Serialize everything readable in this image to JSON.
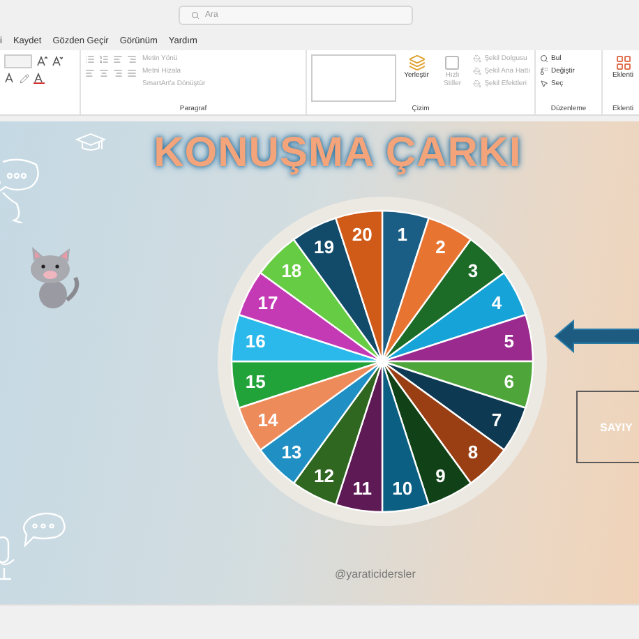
{
  "search": {
    "placeholder": "Ara"
  },
  "menu": [
    {
      "label": "i"
    },
    {
      "label": "Kaydet"
    },
    {
      "label": "Gözden Geçir"
    },
    {
      "label": "Görünüm"
    },
    {
      "label": "Yardım"
    }
  ],
  "ribbon": {
    "paragraph": {
      "label": "Paragraf",
      "commands": [
        {
          "label": "Metin Yönü",
          "disabled": true
        },
        {
          "label": "Metni Hizala",
          "disabled": true
        },
        {
          "label": "SmartArt'a Dönüştür",
          "disabled": true
        }
      ]
    },
    "drawing": {
      "label": "Çizim",
      "arrange": {
        "label": "Yerleştir",
        "disabled": false
      },
      "quick_styles": {
        "label": "Hızlı Stiller",
        "disabled": true
      },
      "commands": [
        {
          "label": "Şekil Dolgusu",
          "disabled": true
        },
        {
          "label": "Şekil Ana Hattı",
          "disabled": true
        },
        {
          "label": "Şekil Efektleri",
          "disabled": true
        }
      ]
    },
    "editing": {
      "label": "Düzenleme",
      "commands": [
        {
          "kind": "find",
          "label": "Bul"
        },
        {
          "kind": "replace",
          "label": "Değiştir"
        },
        {
          "kind": "select",
          "label": "Seç"
        }
      ]
    },
    "addins": {
      "label": "Eklenti",
      "button": "Eklenti"
    }
  },
  "slide": {
    "title": "KONUŞMA ÇARKI",
    "credit": "@yaraticidersler",
    "box_text": "SAYIY",
    "wheel": [
      {
        "number": "1",
        "color": "#1a5e85"
      },
      {
        "number": "2",
        "color": "#e87432"
      },
      {
        "number": "3",
        "color": "#1c6b27"
      },
      {
        "number": "4",
        "color": "#16a3d8"
      },
      {
        "number": "5",
        "color": "#9b2a8e"
      },
      {
        "number": "6",
        "color": "#4ea63a"
      },
      {
        "number": "7",
        "color": "#0d3a52"
      },
      {
        "number": "8",
        "color": "#9a3f13"
      },
      {
        "number": "9",
        "color": "#114217"
      },
      {
        "number": "10",
        "color": "#0b5f82"
      },
      {
        "number": "11",
        "color": "#5e1a55"
      },
      {
        "number": "12",
        "color": "#2f6620"
      },
      {
        "number": "13",
        "color": "#2090c4"
      },
      {
        "number": "14",
        "color": "#ee8b5a"
      },
      {
        "number": "15",
        "color": "#22a33a"
      },
      {
        "number": "16",
        "color": "#2bb8ea"
      },
      {
        "number": "17",
        "color": "#c43ab5"
      },
      {
        "number": "18",
        "color": "#66cc44"
      },
      {
        "number": "19",
        "color": "#124a6a"
      },
      {
        "number": "20",
        "color": "#d05a18"
      }
    ]
  }
}
